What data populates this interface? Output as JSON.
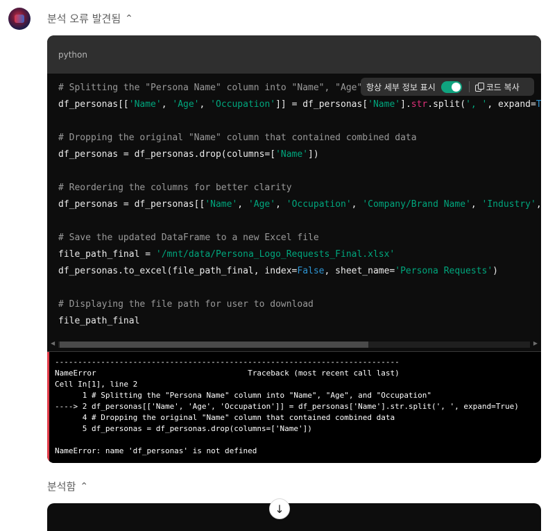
{
  "status1": {
    "label": "분석 오류 발견됨",
    "chevron": "^"
  },
  "status2": {
    "label": "분석함",
    "chevron": "^"
  },
  "code_block": {
    "language": "python",
    "lines": [
      "# Splitting the \"Persona Name\" column into \"Name\", \"Age\", and \"Occupation\"",
      "df_personas[['Name', 'Age', 'Occupation']] = df_personas['Name'].str.split(', ', expand=True)",
      "",
      "# Dropping the original \"Name\" column that contained combined data",
      "df_personas = df_personas.drop(columns=['Name'])",
      "",
      "# Reordering the columns for better clarity",
      "df_personas = df_personas[['Name', 'Age', 'Occupation', 'Company/Brand Name', 'Industry', 'Logo Requirements']]",
      "",
      "# Save the updated DataFrame to a new Excel file",
      "file_path_final = '/mnt/data/Persona_Logo_Requests_Final.xlsx'",
      "df_personas.to_excel(file_path_final, index=False, sheet_name='Persona Requests')",
      "",
      "# Displaying the file path for user to download",
      "file_path_final"
    ]
  },
  "toolbar": {
    "toggle_label": "항상 세부 정보 표시",
    "toggle_on": true,
    "copy_label": "코드 복사"
  },
  "error_output": {
    "text": "---------------------------------------------------------------------------\nNameError                                 Traceback (most recent call last)\nCell In[1], line 2\n      1 # Splitting the \"Persona Name\" column into \"Name\", \"Age\", and \"Occupation\"\n----> 2 df_personas[['Name', 'Age', 'Occupation']] = df_personas['Name'].str.split(', ', expand=True)\n      4 # Dropping the original \"Name\" column that contained combined data\n      5 df_personas = df_personas.drop(columns=['Name'])\n\nNameError: name 'df_personas' is not defined"
  },
  "colors": {
    "accent_toggle": "#10a37f",
    "error_bar": "#e23d4a",
    "string": "#00a67d",
    "keyword": "#2e95d3",
    "comment": "#9a9a9a"
  }
}
